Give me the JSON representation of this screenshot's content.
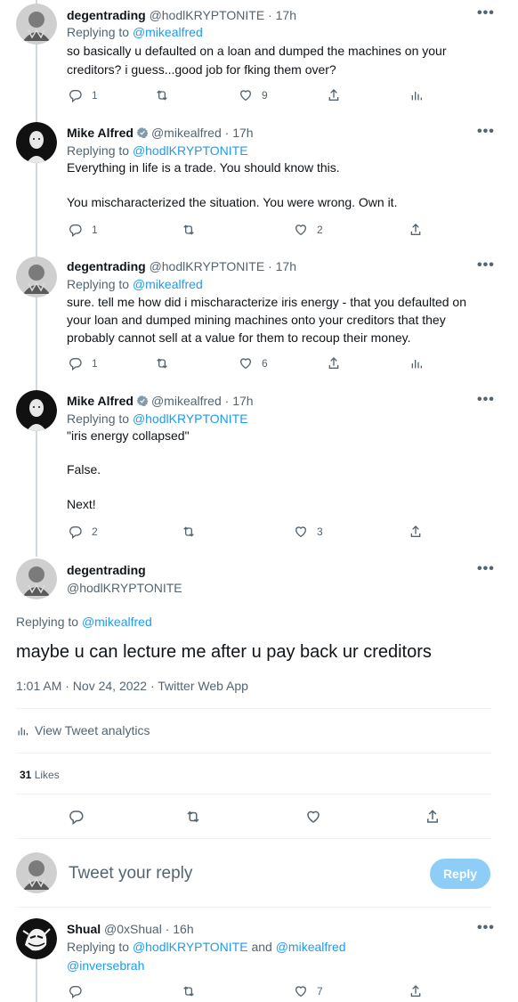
{
  "tweets": [
    {
      "name": "degentrading",
      "handle": "@hodlKRYPTONITE",
      "time": "· 17h",
      "replying_prefix": "Replying to",
      "replying_to": "@mikealfred",
      "lines": [
        "so basically u defaulted on a loan and dumped the machines on your",
        "creditors? i guess...good job for fking them over?"
      ],
      "replies": "1",
      "likes": "9"
    },
    {
      "name": "Mike Alfred",
      "handle": "@mikealfred",
      "time": "· 17h",
      "replying_prefix": "Replying to",
      "replying_to": "@hodlKRYPTONITE",
      "lines": [
        "Everything in life is a trade. You should know this.",
        "You mischaracterized the situation. You were wrong. Own it."
      ],
      "replies": "1",
      "likes": "2"
    },
    {
      "name": "degentrading",
      "handle": "@hodlKRYPTONITE",
      "time": "· 17h",
      "replying_prefix": "Replying to",
      "replying_to": "@mikealfred",
      "lines": [
        "sure. tell me how did i mischaracterize iris energy - that you defaulted on",
        "your loan and dumped mining machines onto your creditors that they",
        "probably cannot sell at a value for them to recoup their money."
      ],
      "replies": "1",
      "likes": "6"
    },
    {
      "name": "Mike Alfred",
      "handle": "@mikealfred",
      "time": "· 17h",
      "replying_prefix": "Replying to",
      "replying_to": "@hodlKRYPTONITE",
      "lines": [
        "\"iris energy collapsed\"",
        "False.",
        "Next!"
      ],
      "replies": "2",
      "likes": "3"
    }
  ],
  "main_tweet": {
    "name": "degentrading",
    "handle": "@hodlKRYPTONITE",
    "replying_prefix": "Replying to",
    "replying_to": "@mikealfred",
    "text": "maybe u can lecture me after u pay back ur creditors",
    "meta": "1:01 AM · Nov 24, 2022 · Twitter Web App",
    "analytics": "View Tweet analytics",
    "likes_count": "31",
    "likes_label": "Likes"
  },
  "compose": {
    "placeholder": "Tweet your reply",
    "button": "Reply"
  },
  "reply_tweet": {
    "name": "Shual",
    "handle": "@0xShual",
    "time": "· 16h",
    "replying_prefix": "Replying to",
    "replying_to_1": "@hodlKRYPTONITE",
    "and": "and",
    "replying_to_2": "@mikealfred",
    "replying_to_3": "@inversebrah",
    "likes": "7"
  },
  "more_label": "•••",
  "colors": {
    "accent": "#1d9bf0",
    "muted": "#536471",
    "reply_button": "#8ecdf7"
  }
}
